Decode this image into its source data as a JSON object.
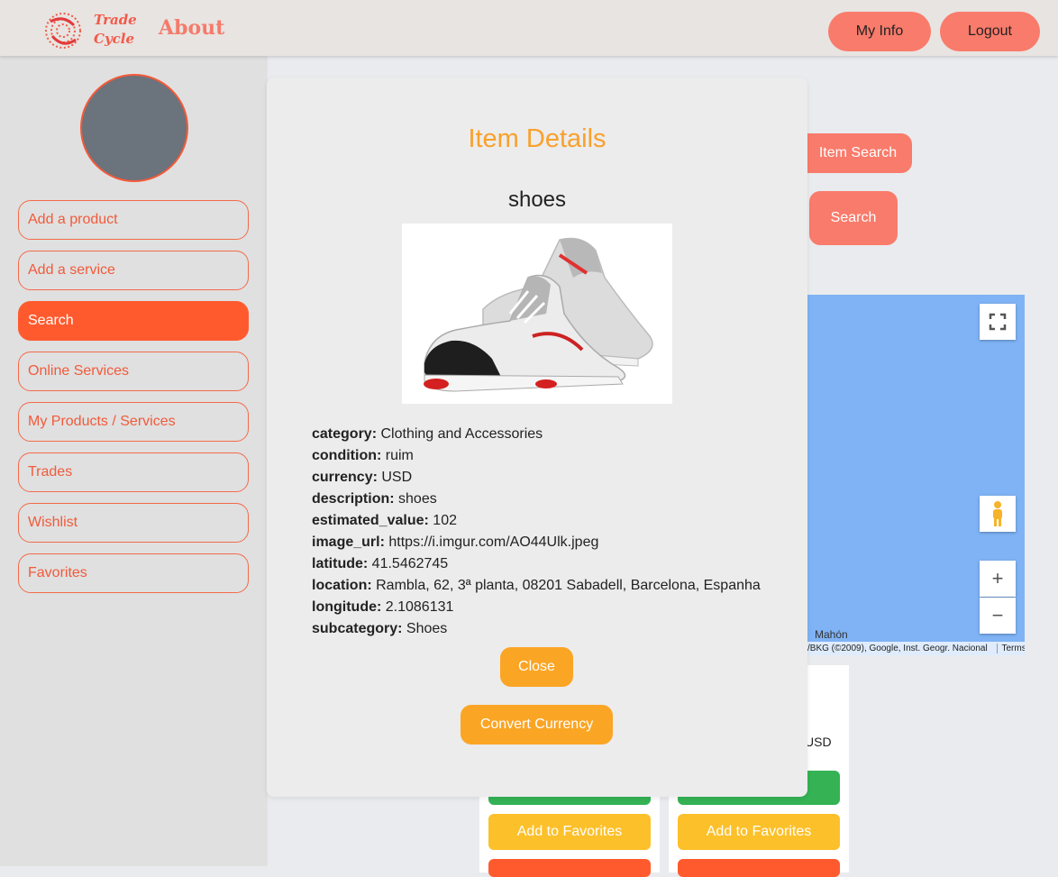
{
  "header": {
    "logo_line1": "Trade",
    "logo_line2": "Cycle",
    "about_label": "About",
    "my_info_label": "My Info",
    "logout_label": "Logout"
  },
  "sidebar": {
    "items": [
      {
        "label": "Add a product"
      },
      {
        "label": "Add a service"
      },
      {
        "label": "Search"
      },
      {
        "label": "Online Services"
      },
      {
        "label": "My Products / Services"
      },
      {
        "label": "Trades"
      },
      {
        "label": "Wishlist"
      },
      {
        "label": "Favorites"
      }
    ],
    "active_item": "Search"
  },
  "background": {
    "item_search_label": "Item Search",
    "search_label": "Search",
    "map_place": "Mahón",
    "map_attribution": "/BKG (©2009), Google, Inst. Geogr. Nacional",
    "map_terms": "Terms",
    "card_currency": "USD",
    "add_to_favorites_label": "Add to Favorites"
  },
  "modal": {
    "title": "Item Details",
    "item_name": "shoes",
    "details": [
      {
        "key": "category:",
        "value": "Clothing and Accessories"
      },
      {
        "key": "condition:",
        "value": "ruim"
      },
      {
        "key": "currency:",
        "value": "USD"
      },
      {
        "key": "description:",
        "value": "shoes"
      },
      {
        "key": "estimated_value:",
        "value": "102"
      },
      {
        "key": "image_url:",
        "value": "https://i.imgur.com/AO44Ulk.jpeg"
      },
      {
        "key": "latitude:",
        "value": "41.5462745"
      },
      {
        "key": "location:",
        "value": "Rambla, 62, 3ª planta, 08201 Sabadell, Barcelona, Espanha"
      },
      {
        "key": "longitude:",
        "value": "2.1086131"
      },
      {
        "key": "subcategory:",
        "value": "Shoes"
      }
    ],
    "close_label": "Close",
    "convert_label": "Convert Currency"
  },
  "colors": {
    "accent_orange": "#ff5a2e",
    "header_button": "#f97b6b",
    "modal_title": "#f9a02c",
    "modal_button": "#fba524"
  }
}
